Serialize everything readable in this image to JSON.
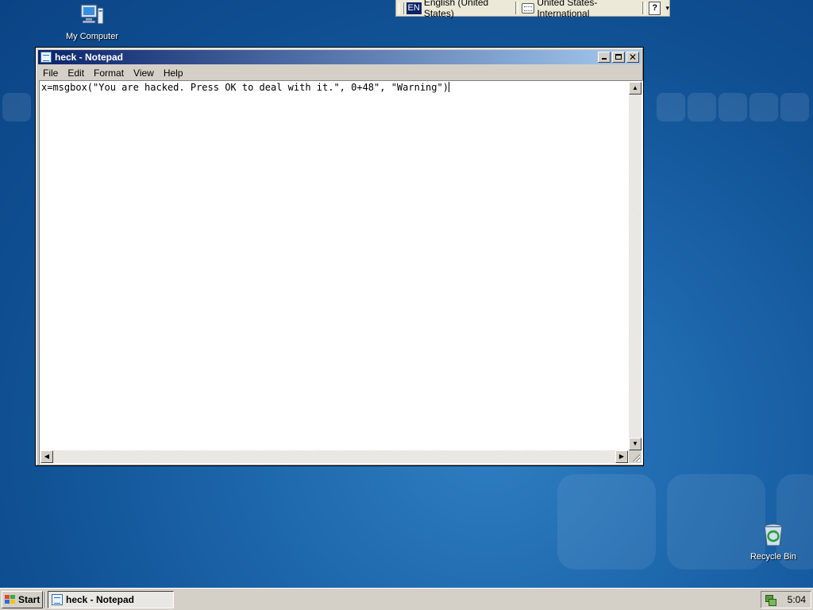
{
  "desktop": {
    "icons": [
      {
        "label": "My Computer"
      },
      {
        "label": "Recycle Bin"
      }
    ]
  },
  "language_bar": {
    "lang_code": "EN",
    "language": "English (United States)",
    "keyboard": "United States-International",
    "help_symbol": "?"
  },
  "notepad": {
    "title": "heck - Notepad",
    "menu": [
      "File",
      "Edit",
      "Format",
      "View",
      "Help"
    ],
    "content": "x=msgbox(\"You are hacked. Press OK to deal with it.\", 0+48\", \"Warning\")"
  },
  "taskbar": {
    "start_label": "Start",
    "task_label": "heck - Notepad",
    "clock": "5:04"
  },
  "colors": {
    "title_gradient_start": "#0a246a",
    "title_gradient_end": "#a6caf0",
    "desktop_blue": "#1d66ab",
    "chrome_gray": "#d4d0c8"
  }
}
